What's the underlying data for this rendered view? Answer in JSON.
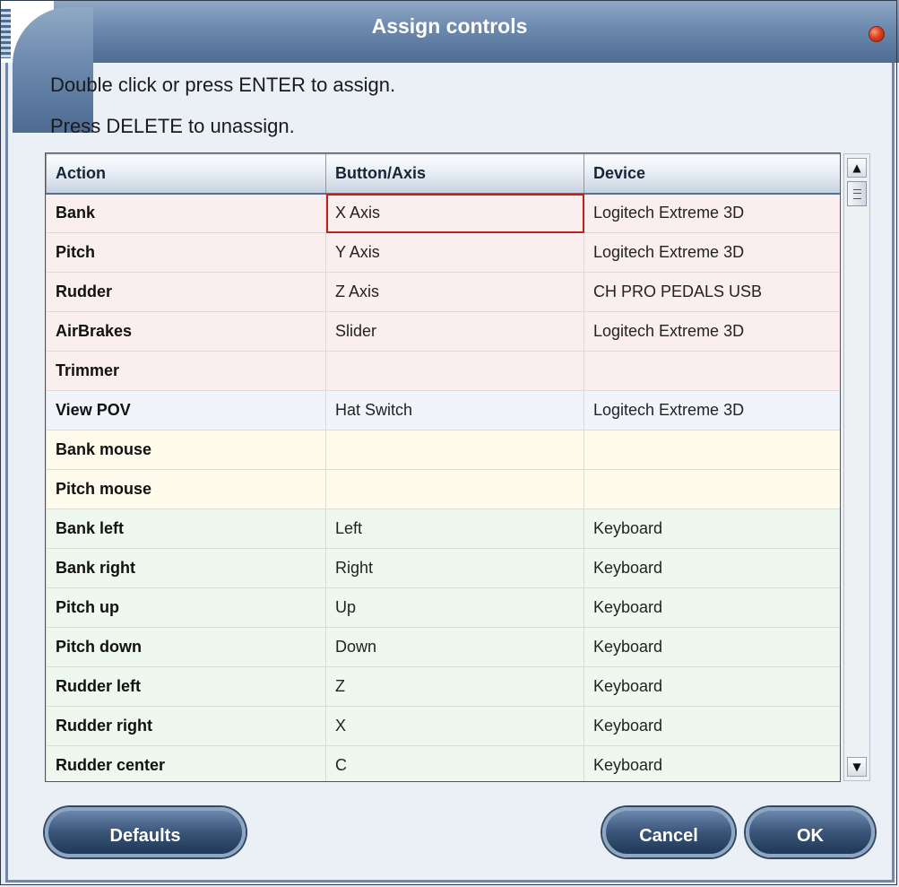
{
  "window": {
    "title": "Assign controls"
  },
  "instructions": {
    "line1": "Double click or press ENTER to assign.",
    "line2": "Press DELETE to unassign."
  },
  "table": {
    "headers": [
      "Action",
      "Button/Axis",
      "Device"
    ],
    "rows": [
      {
        "action": "Bank",
        "button": "X Axis",
        "device": "Logitech Extreme 3D",
        "group": "axis",
        "selected": true
      },
      {
        "action": "Pitch",
        "button": "Y Axis",
        "device": "Logitech Extreme 3D",
        "group": "axis"
      },
      {
        "action": "Rudder",
        "button": "Z Axis",
        "device": "CH PRO PEDALS USB",
        "group": "axis"
      },
      {
        "action": "AirBrakes",
        "button": "Slider",
        "device": "Logitech Extreme 3D",
        "group": "axis"
      },
      {
        "action": "Trimmer",
        "button": "",
        "device": "",
        "group": "axis"
      },
      {
        "action": "View POV",
        "button": "Hat Switch",
        "device": "Logitech Extreme 3D",
        "group": "pov"
      },
      {
        "action": "Bank mouse",
        "button": "",
        "device": "",
        "group": "mouse"
      },
      {
        "action": "Pitch mouse",
        "button": "",
        "device": "",
        "group": "mouse"
      },
      {
        "action": "Bank left",
        "button": "Left",
        "device": "Keyboard",
        "group": "key"
      },
      {
        "action": "Bank right",
        "button": "Right",
        "device": "Keyboard",
        "group": "key"
      },
      {
        "action": "Pitch up",
        "button": "Up",
        "device": "Keyboard",
        "group": "key"
      },
      {
        "action": "Pitch down",
        "button": "Down",
        "device": "Keyboard",
        "group": "key"
      },
      {
        "action": "Rudder left",
        "button": "Z",
        "device": "Keyboard",
        "group": "key"
      },
      {
        "action": "Rudder right",
        "button": "X",
        "device": "Keyboard",
        "group": "key"
      },
      {
        "action": "Rudder center",
        "button": "C",
        "device": "Keyboard",
        "group": "key"
      }
    ]
  },
  "buttons": {
    "defaults": "Defaults",
    "cancel": "Cancel",
    "ok": "OK"
  },
  "icons": {
    "close": "close-icon",
    "scroll_up": "scroll-up-arrow-icon",
    "scroll_down": "scroll-down-arrow-icon",
    "grip": "scroll-grip-icon"
  },
  "colors": {
    "title_bar": "#6c89ae",
    "row_axis": "#fbeeee",
    "row_pov": "#f1f4fa",
    "row_mouse": "#fffbec",
    "row_key": "#eef8ef",
    "selection": "#c4201a"
  }
}
